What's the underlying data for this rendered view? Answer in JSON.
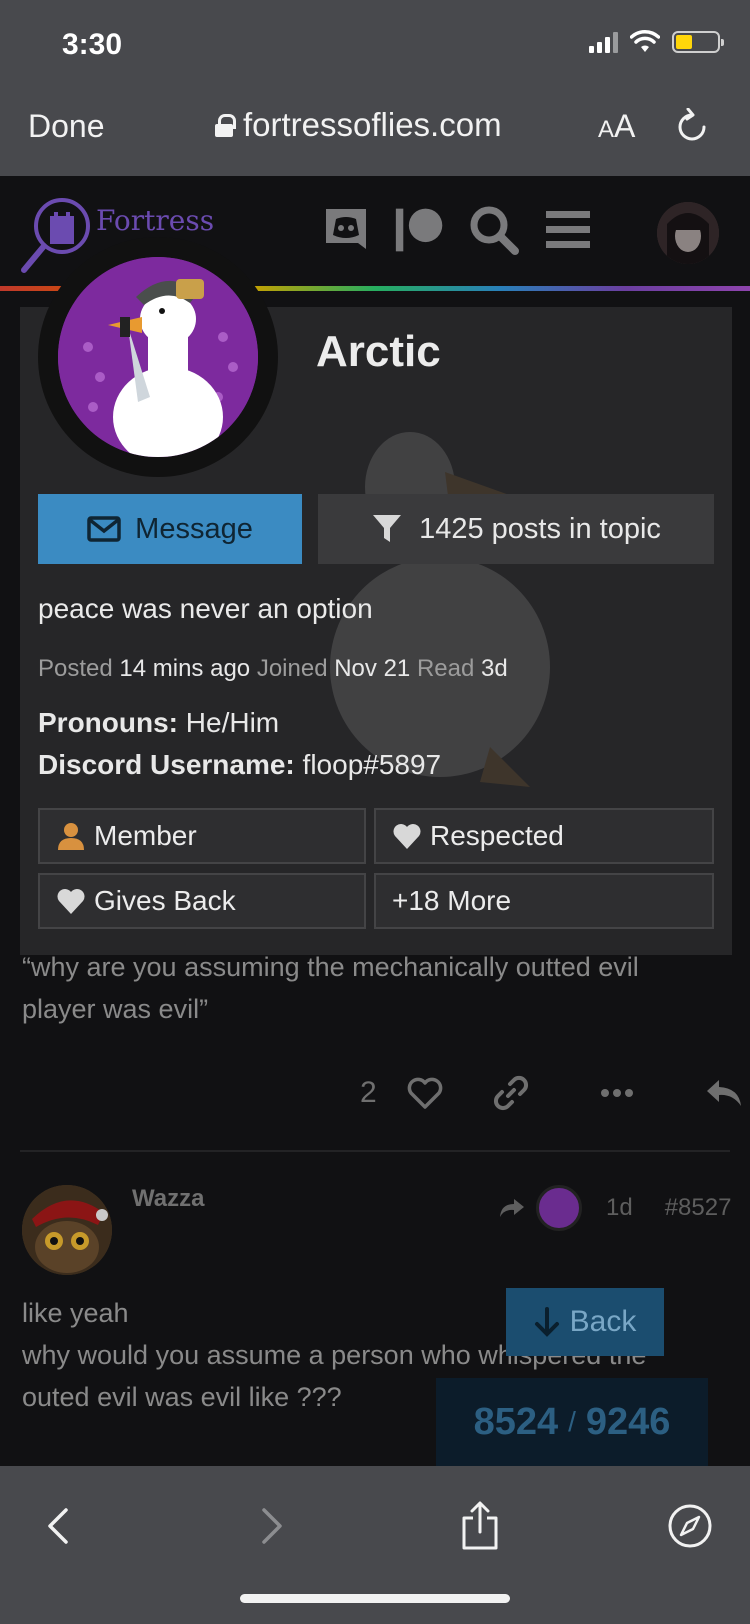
{
  "status": {
    "time": "3:30"
  },
  "safari": {
    "done_label": "Done",
    "url": "fortressoflies.com",
    "aa_small": "A",
    "aa_big": "A"
  },
  "site": {
    "logo_text": "Fortress"
  },
  "card": {
    "username": "Arctic",
    "message_label": "Message",
    "posts_in_topic_label": "1425 posts in topic",
    "bio": "peace was never an option",
    "posted_label": "Posted",
    "posted_value": "14 mins ago",
    "joined_label": "Joined",
    "joined_value": "Nov 21",
    "read_label": "Read",
    "read_value": "3d",
    "pronouns_label": "Pronouns:",
    "pronouns_value": "He/Him",
    "discord_label": "Discord Username:",
    "discord_value": "floop#5897",
    "badges": [
      "Member",
      "Respected",
      "Gives Back",
      "+18 More"
    ]
  },
  "post": {
    "quote_line1": "“why are you assuming the mechanically outted evil",
    "quote_line2": "player was evil”",
    "like_count": "2"
  },
  "reply": {
    "author": "Wazza",
    "age": "1d",
    "post_number": "#8527",
    "line1": "like yeah",
    "line2": "why would you assume a person who whispered the",
    "line3": "outed evil was evil like ???"
  },
  "nav": {
    "back_label": "Back",
    "current": "8524",
    "separator": "/",
    "total": "9246"
  },
  "colors": {
    "accent": "#3b8bc2",
    "logo": "#6b4bb0",
    "member_icon": "#d8913f"
  }
}
